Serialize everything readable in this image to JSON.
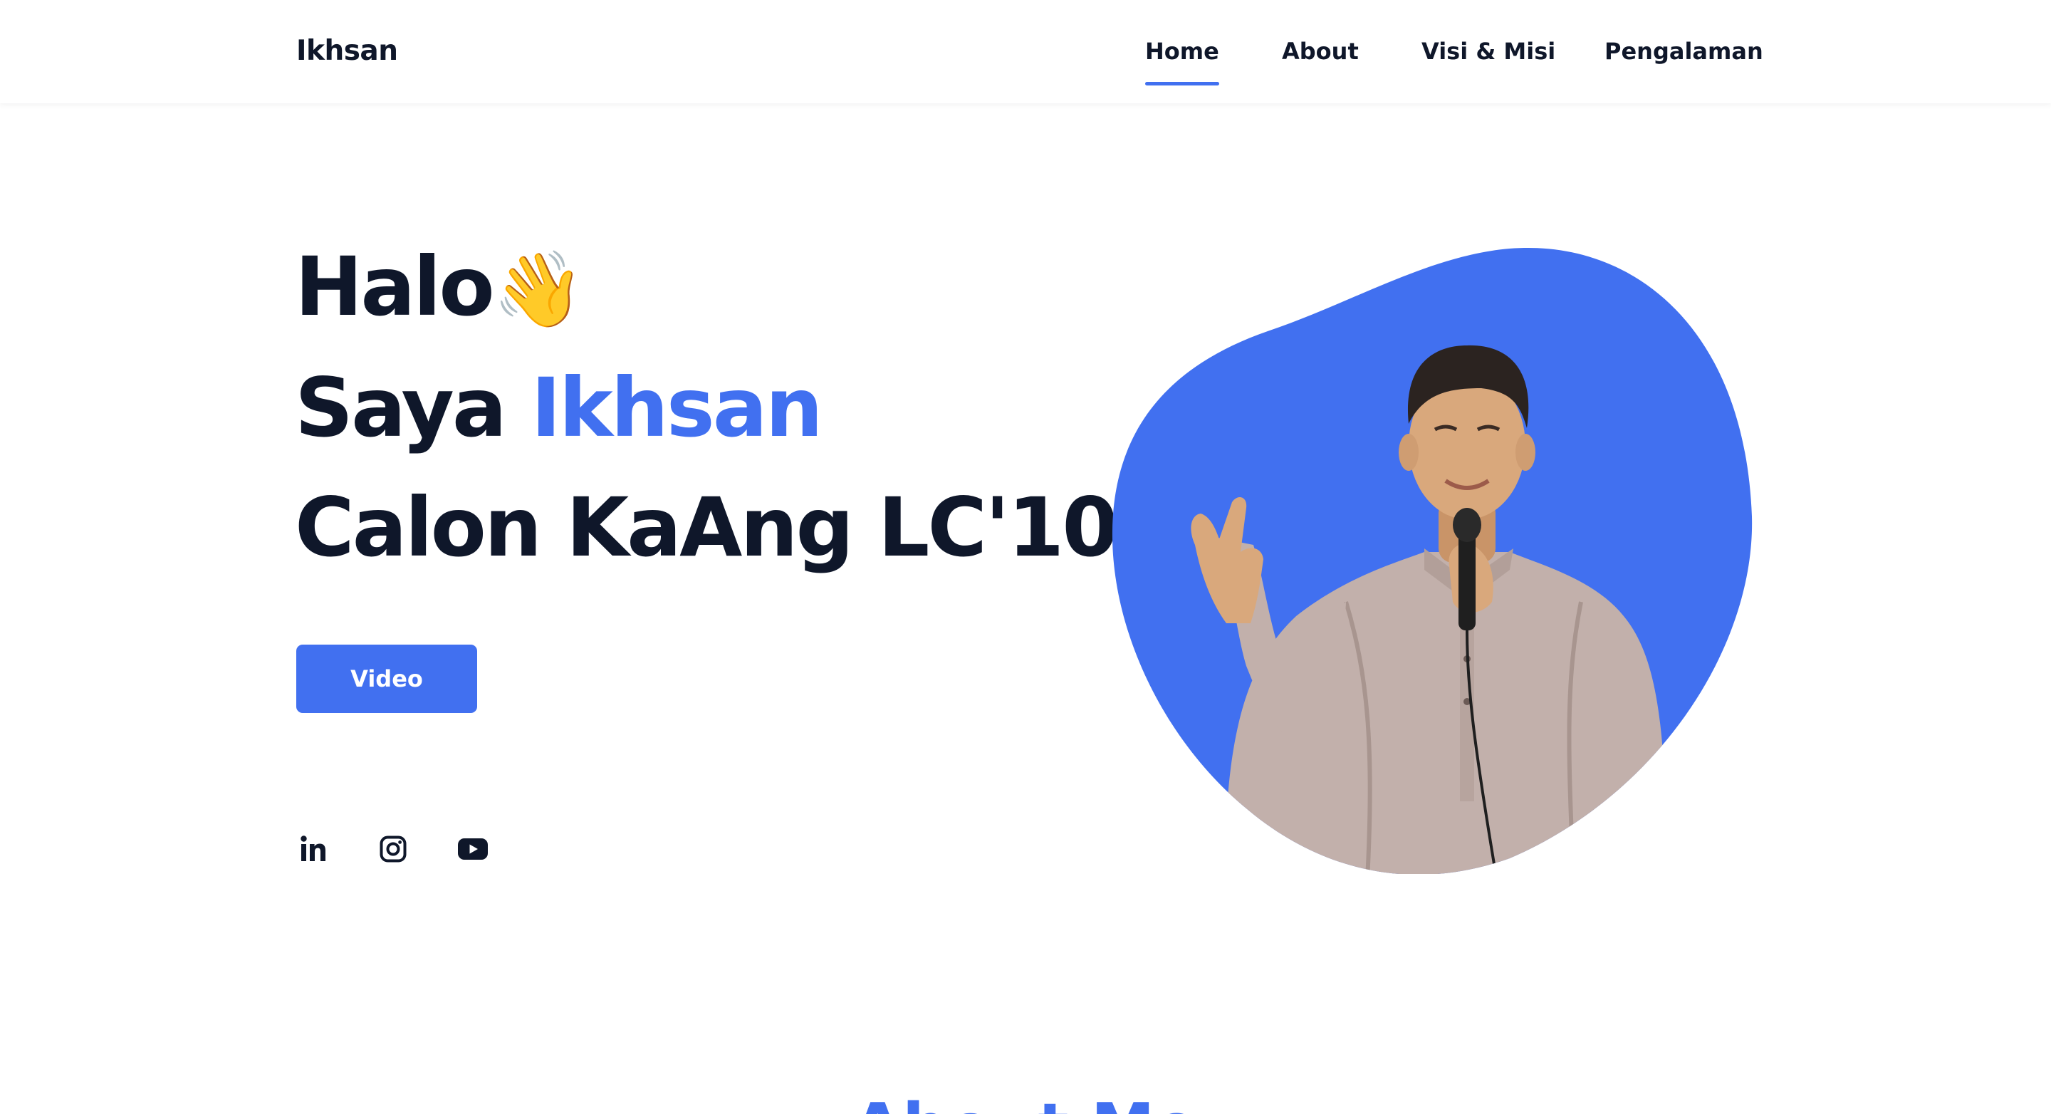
{
  "header": {
    "logo": "Ikhsan",
    "nav": [
      {
        "label": "Home",
        "active": true
      },
      {
        "label": "About",
        "active": false
      },
      {
        "label": "Visi & Misi",
        "active": false
      },
      {
        "label": "Pengalaman",
        "active": false
      }
    ]
  },
  "hero": {
    "greeting": "Halo",
    "greeting_emoji": "👋",
    "intro_prefix": "Saya ",
    "name": "Ikhsan",
    "tagline": "Calon KaAng LC'10",
    "video_button": "Video",
    "social_icons": [
      "linkedin-icon",
      "instagram-icon",
      "youtube-icon"
    ]
  },
  "next_section": {
    "title": "About Me"
  },
  "colors": {
    "accent": "#4170f0",
    "text_dark": "#0f172a",
    "background": "#ffffff",
    "shirt": "#c2b0ab",
    "skin": "#d9a87c"
  }
}
